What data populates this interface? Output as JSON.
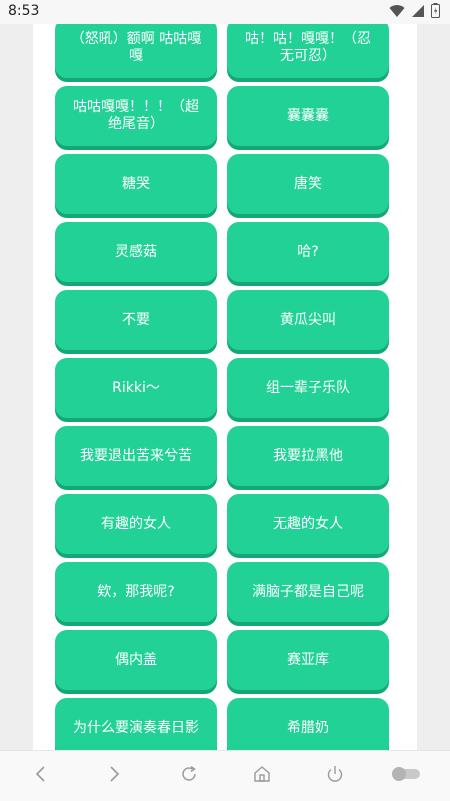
{
  "status_bar": {
    "time": "8:53"
  },
  "buttons": [
    "（怒吼）额啊 咕咕嘎嘎",
    "咕！咕！嘎嘎！（忍无可忍）",
    "咕咕嘎嘎！！！（超绝尾音）",
    "囊囊囊",
    "糖哭",
    "唐笑",
    "灵感菇",
    "哈?",
    "不要",
    "黄瓜尖叫",
    "Rikki～",
    "组一辈子乐队",
    "我要退出苦来兮苦",
    "我要拉黑他",
    "有趣的女人",
    "无趣的女人",
    "欸，那我呢?",
    "满脑子都是自己呢",
    "偶内盖",
    "赛亚库",
    "为什么要演奏春日影",
    "希腊奶"
  ],
  "colors": {
    "button": "#22d195",
    "button_shadow": "#15a877",
    "nav_icon": "#9a9a9a"
  },
  "icons": {
    "status": [
      "wifi-icon",
      "signal-icon",
      "battery-icon"
    ],
    "nav": [
      "back-icon",
      "forward-icon",
      "refresh-icon",
      "home-icon",
      "power-icon",
      "toggle-icon"
    ]
  }
}
